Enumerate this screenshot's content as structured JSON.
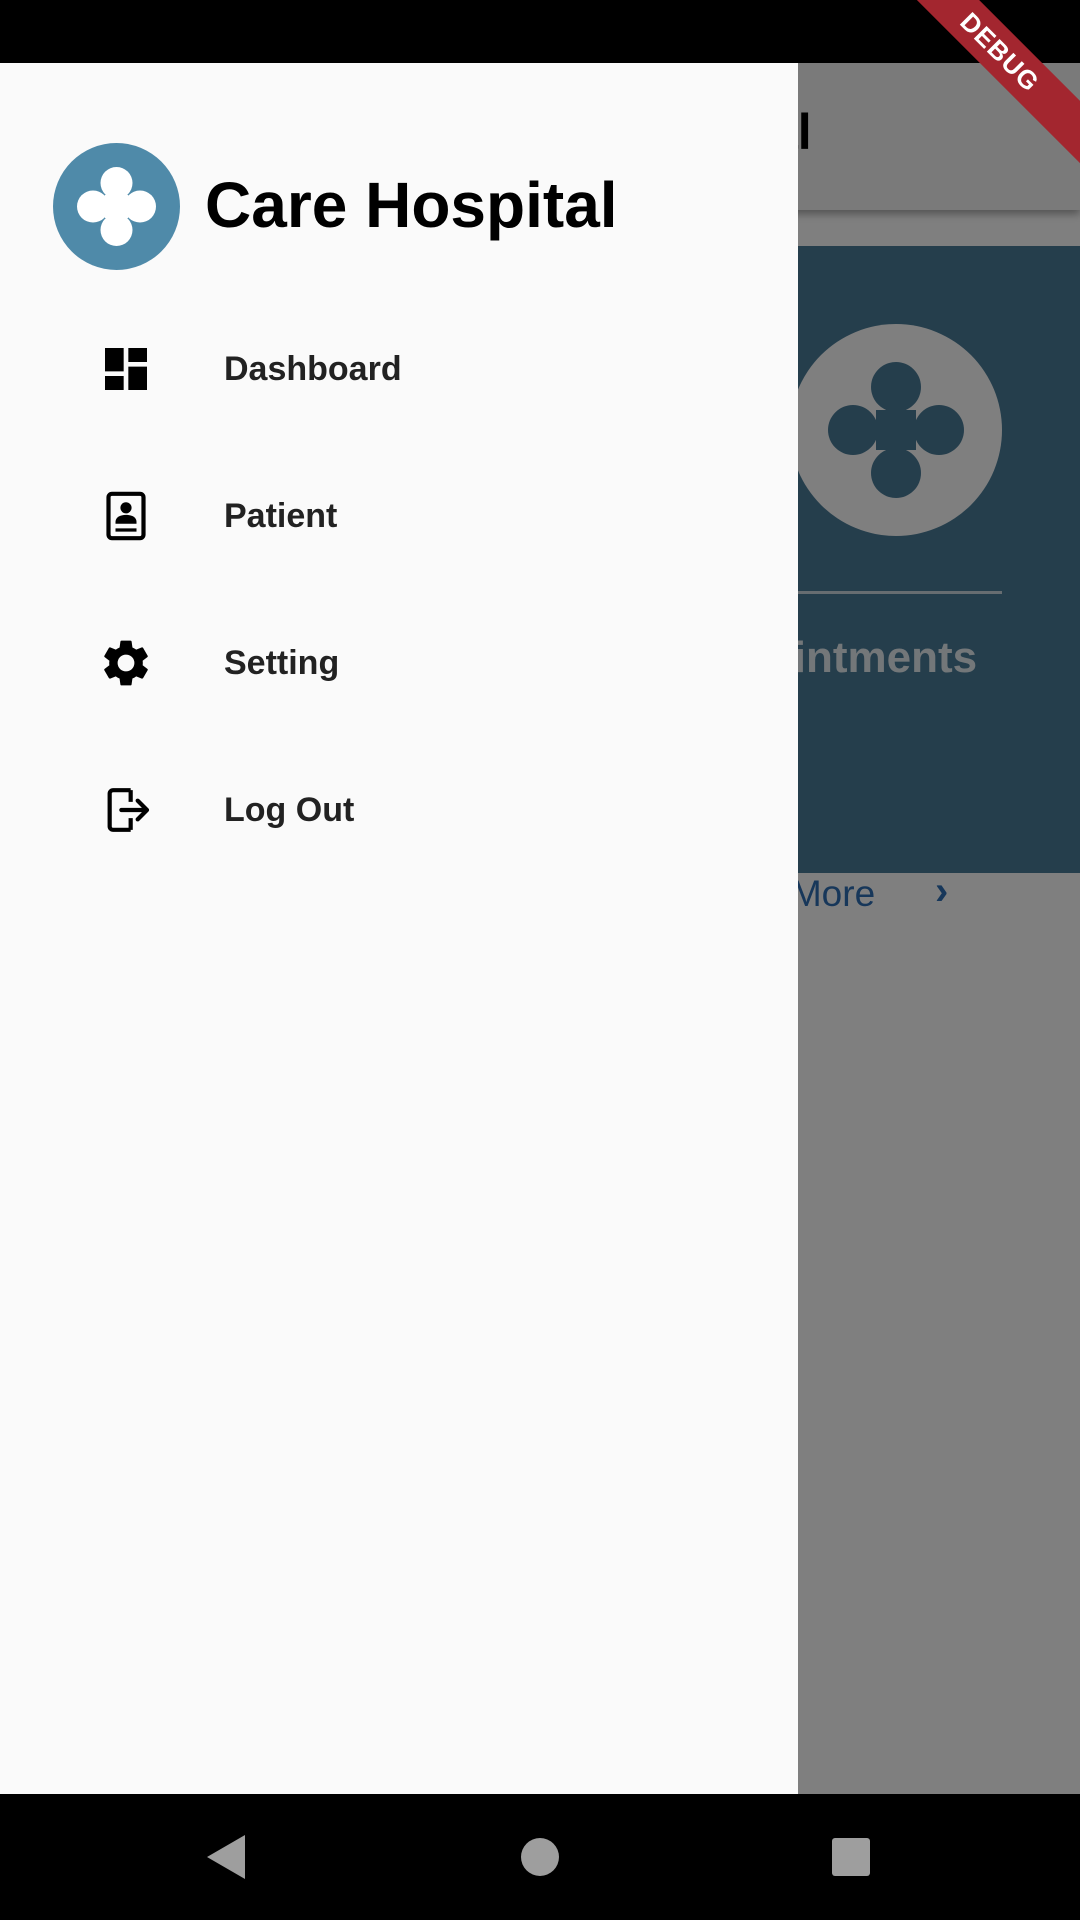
{
  "drawer": {
    "title": "Care Hospital",
    "logo_icon": "clover-logo-icon",
    "items": [
      {
        "label": "Dashboard",
        "icon": "dashboard-icon"
      },
      {
        "label": "Patient",
        "icon": "contact-card-icon"
      },
      {
        "label": "Setting",
        "icon": "gear-icon"
      },
      {
        "label": "Log Out",
        "icon": "logout-icon"
      }
    ]
  },
  "background": {
    "app_title_fragment": "al",
    "card_text_fragment": "pointments",
    "see_more_fragment": "e More"
  },
  "debug_banner": "DEBUG",
  "colors": {
    "brand": "#4f8aa9",
    "card": "#4a7c99",
    "link": "#2f6fb5",
    "drawer_bg": "#fafafa"
  }
}
